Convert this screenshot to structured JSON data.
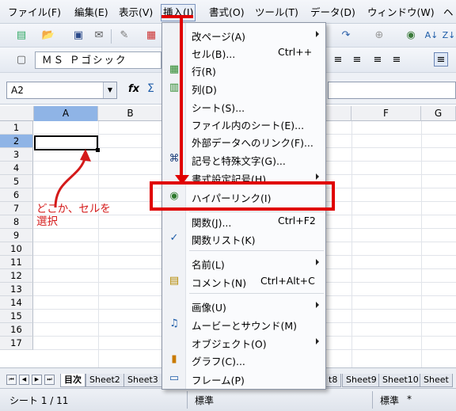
{
  "menubar": {
    "items": [
      "ファイル(F)",
      "編集(E)",
      "表示(V)",
      "挿入(I)",
      "書式(O)",
      "ツール(T)",
      "データ(D)",
      "ウィンドウ(W)",
      "ヘ"
    ]
  },
  "toolbar": {
    "font_name": "ＭＳ Ｐゴシック"
  },
  "formula_bar": {
    "namebox_value": "A2",
    "fx": "fx",
    "sum": "Σ"
  },
  "grid": {
    "columns": [
      "A",
      "B",
      "F",
      "G"
    ],
    "rows": [
      "1",
      "2",
      "3",
      "4",
      "5",
      "6",
      "7",
      "8",
      "9",
      "10",
      "11",
      "12",
      "13",
      "14",
      "15",
      "16",
      "17"
    ],
    "selected_cell": "A2"
  },
  "annotation": {
    "line1": "どこか、セルを",
    "line2": "選択"
  },
  "sheet_tabs": {
    "tabs": [
      "目次",
      "Sheet2",
      "Sheet3",
      "t8",
      "Sheet9",
      "Sheet10",
      "Sheet"
    ]
  },
  "status_bar": {
    "sheet_info": "シート 1 / 11",
    "style": "標準",
    "mode": "標準",
    "modified": "*"
  },
  "dropdown": {
    "items": [
      {
        "label": "改ページ(A)",
        "shortcut": "",
        "submenu": true,
        "icon": ""
      },
      {
        "label": "セル(B)...",
        "shortcut": "Ctrl++",
        "submenu": false,
        "icon": ""
      },
      {
        "label": "行(R)",
        "shortcut": "",
        "submenu": false,
        "icon": "insert-rows-icon"
      },
      {
        "label": "列(D)",
        "shortcut": "",
        "submenu": false,
        "icon": "insert-columns-icon"
      },
      {
        "label": "シート(S)...",
        "shortcut": "",
        "submenu": false,
        "icon": ""
      },
      {
        "label": "ファイル内のシート(E)...",
        "shortcut": "",
        "submenu": false,
        "icon": ""
      },
      {
        "label": "外部データへのリンク(F)...",
        "shortcut": "",
        "submenu": false,
        "icon": ""
      },
      {
        "label": "記号と特殊文字(G)...",
        "shortcut": "",
        "submenu": false,
        "icon": "special-character-icon"
      },
      {
        "label": "書式設定記号(H)",
        "shortcut": "",
        "submenu": true,
        "icon": ""
      },
      {
        "label": "ハイパーリンク(I)",
        "shortcut": "",
        "submenu": false,
        "icon": "hyperlink-icon"
      },
      {
        "label": "関数(J)...",
        "shortcut": "Ctrl+F2",
        "submenu": false,
        "icon": ""
      },
      {
        "label": "関数リスト(K)",
        "shortcut": "",
        "submenu": false,
        "icon": "checkmark-icon"
      },
      {
        "label": "名前(L)",
        "shortcut": "",
        "submenu": true,
        "icon": ""
      },
      {
        "label": "コメント(N)",
        "shortcut": "Ctrl+Alt+C",
        "submenu": false,
        "icon": "comment-icon"
      },
      {
        "label": "画像(U)",
        "shortcut": "",
        "submenu": true,
        "icon": ""
      },
      {
        "label": "ムービーとサウンド(M)",
        "shortcut": "",
        "submenu": false,
        "icon": "movie-sound-icon"
      },
      {
        "label": "オブジェクト(O)",
        "shortcut": "",
        "submenu": true,
        "icon": ""
      },
      {
        "label": "グラフ(C)...",
        "shortcut": "",
        "submenu": false,
        "icon": "chart-icon"
      },
      {
        "label": "フレーム(P)",
        "shortcut": "",
        "submenu": false,
        "icon": "frame-icon"
      }
    ]
  },
  "colors": {
    "highlight_red": "#e00000",
    "annotation_red": "#d41a1a",
    "selection_blue": "#8fb4e6"
  }
}
